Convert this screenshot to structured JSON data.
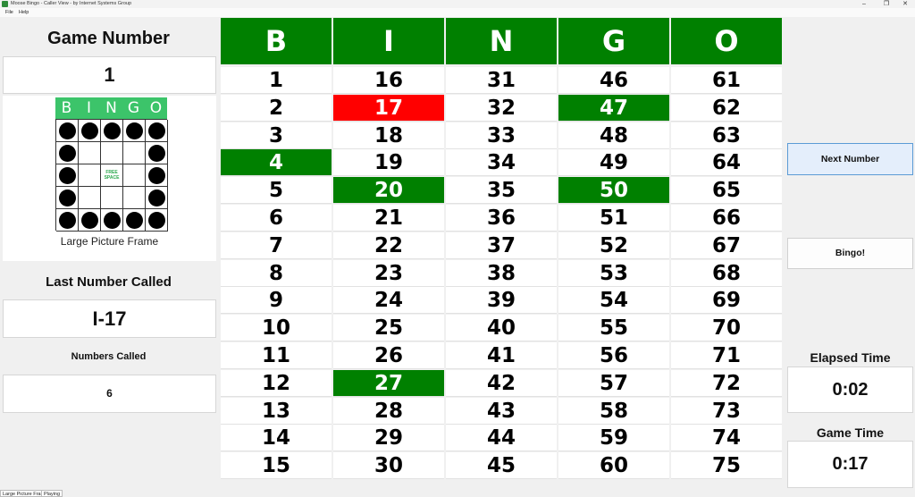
{
  "window": {
    "title": "Moose Bingo - Caller View - by Internet Systems Group",
    "minimize": "–",
    "restore": "❐",
    "close": "✕",
    "icon": "moose-bingo-app-icon"
  },
  "menu": {
    "items": [
      "File",
      "Help"
    ]
  },
  "left": {
    "game_number_label": "Game Number",
    "game_number_value": "1",
    "pattern": {
      "header_letters": [
        "B",
        "I",
        "N",
        "G",
        "O"
      ],
      "free_space_text": "FREE SPACE",
      "filled": [
        [
          1,
          1,
          1,
          1,
          1
        ],
        [
          1,
          0,
          0,
          0,
          1
        ],
        [
          1,
          0,
          2,
          0,
          1
        ],
        [
          1,
          0,
          0,
          0,
          1
        ],
        [
          1,
          1,
          1,
          1,
          1
        ]
      ],
      "name": "Large Picture Frame"
    },
    "last_called_label": "Last Number Called",
    "last_called_value": "I-17",
    "numbers_called_label": "Numbers Called",
    "numbers_called_value": "6"
  },
  "board": {
    "headers": [
      "B",
      "I",
      "N",
      "G",
      "O"
    ],
    "columns": [
      [
        "1",
        "2",
        "3",
        "4",
        "5",
        "6",
        "7",
        "8",
        "9",
        "10",
        "11",
        "12",
        "13",
        "14",
        "15"
      ],
      [
        "16",
        "17",
        "18",
        "19",
        "20",
        "21",
        "22",
        "23",
        "24",
        "25",
        "26",
        "27",
        "28",
        "29",
        "30"
      ],
      [
        "31",
        "32",
        "33",
        "34",
        "35",
        "36",
        "37",
        "38",
        "39",
        "40",
        "41",
        "42",
        "43",
        "44",
        "45"
      ],
      [
        "46",
        "47",
        "48",
        "49",
        "50",
        "51",
        "52",
        "53",
        "54",
        "55",
        "56",
        "57",
        "58",
        "59",
        "60"
      ],
      [
        "61",
        "62",
        "63",
        "64",
        "65",
        "66",
        "67",
        "68",
        "69",
        "70",
        "71",
        "72",
        "73",
        "74",
        "75"
      ]
    ],
    "called_numbers": [
      "4",
      "20",
      "27",
      "47",
      "50"
    ],
    "last_called_number": "17",
    "colors": {
      "header": "#008000",
      "called": "#008000",
      "last_called": "#ff0000"
    }
  },
  "right": {
    "next_number_label": "Next Number",
    "bingo_label": "Bingo!",
    "elapsed_time_label": "Elapsed Time",
    "elapsed_time_value": "0:02",
    "game_time_label": "Game Time",
    "game_time_value": "0:17"
  },
  "status": {
    "pattern": "Large Picture Frame",
    "state": "Playing"
  }
}
